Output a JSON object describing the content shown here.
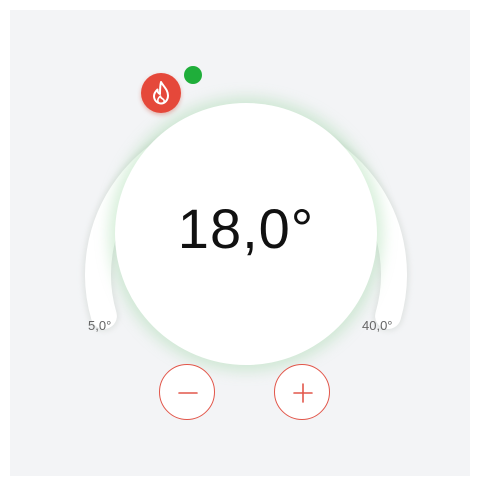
{
  "thermostat": {
    "setpoint": "18,0°",
    "min_label": "5,0°",
    "max_label": "40,0°",
    "mode_icon": "flame-icon",
    "mode_color": "#e5483a",
    "status_color": "#1fae3a",
    "accent_color": "#e2564a"
  },
  "controls": {
    "decrease_icon": "minus-icon",
    "increase_icon": "plus-icon"
  }
}
